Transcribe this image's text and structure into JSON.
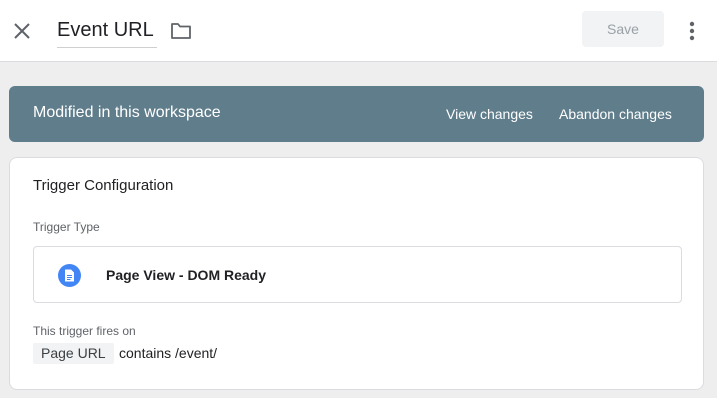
{
  "header": {
    "title": "Event URL",
    "save_label": "Save",
    "icons": [
      "close-icon",
      "folder-icon",
      "more-vert-icon"
    ]
  },
  "banner": {
    "message": "Modified in this workspace",
    "view_changes": "View changes",
    "abandon_changes": "Abandon changes",
    "color": "#607d8b"
  },
  "card": {
    "title": "Trigger Configuration",
    "trigger_type_label": "Trigger Type",
    "trigger_type": "Page View - DOM Ready",
    "trigger_type_icon": "page-document-icon",
    "fires_on_label": "This trigger fires on",
    "condition": {
      "variable": "Page URL",
      "operator_value": "contains /event/"
    }
  },
  "colors": {
    "accent": "#4285f4",
    "background": "#eeeeee"
  }
}
